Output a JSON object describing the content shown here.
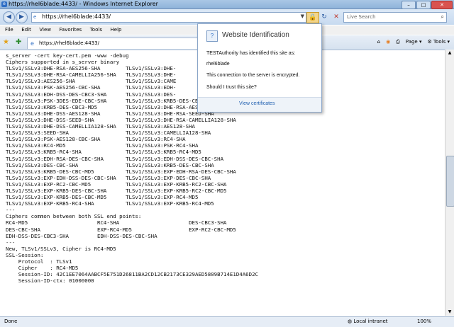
{
  "window": {
    "title": "https://rhel6blade:4433/ - Windows Internet Explorer"
  },
  "nav": {
    "url": "https://rhel6blade:4433/",
    "search_placeholder": "Live Search"
  },
  "menu": [
    "File",
    "Edit",
    "View",
    "Favorites",
    "Tools",
    "Help"
  ],
  "tab": {
    "label": "https://rhel6blade:4433/"
  },
  "toolbar": {
    "page": "Page",
    "tools": "Tools"
  },
  "popup": {
    "title": "Website Identification",
    "line1": "TESTAuthority has identified this site as:",
    "site": "rhel6blade",
    "line2": "This connection to the server is encrypted.",
    "line3": "Should I trust this site?",
    "link": "View certificates"
  },
  "content_lines": [
    "s_server -cert key-cert.pem -www -debug",
    "Ciphers supported in s_server binary",
    "TLSv1/SSLv3:DHE-RSA-AES256-SHA        TLSv1/SSLv3:DHE-",
    "TLSv1/SSLv3:DHE-RSA-CAMELLIA256-SHA   TLSv1/SSLv3:DHE-",
    "TLSv1/SSLv3:AES256-SHA                TLSv1/SSLv3:CAME",
    "TLSv1/SSLv3:PSK-AES256-CBC-SHA        TLSv1/SSLv3:EDH-",
    "TLSv1/SSLv3:EDH-DSS-DES-CBC3-SHA      TLSv1/SSLv3:DES-",
    "TLSv1/SSLv3:PSK-3DES-EDE-CBC-SHA      TLSv1/SSLv3:KRB5-DES-CBC3-SHA",
    "TLSv1/SSLv3:KRB5-DES-CBC3-MD5         TLSv1/SSLv3:DHE-RSA-AES128-SHA",
    "TLSv1/SSLv3:DHE-DSS-AES128-SHA        TLSv1/SSLv3:DHE-RSA-SEED-SHA",
    "TLSv1/SSLv3:DHE-DSS-SEED-SHA          TLSv1/SSLv3:DHE-RSA-CAMELLIA128-SHA",
    "TLSv1/SSLv3:DHE-DSS-CAMELLIA128-SHA   TLSv1/SSLv3:AES128-SHA",
    "TLSv1/SSLv3:SEED-SHA                  TLSv1/SSLv3:CAMELLIA128-SHA",
    "TLSv1/SSLv3:PSK-AES128-CBC-SHA        TLSv1/SSLv3:RC4-SHA",
    "TLSv1/SSLv3:RC4-MD5                   TLSv1/SSLv3:PSK-RC4-SHA",
    "TLSv1/SSLv3:KRB5-RC4-SHA              TLSv1/SSLv3:KRB5-RC4-MD5",
    "TLSv1/SSLv3:EDH-RSA-DES-CBC-SHA       TLSv1/SSLv3:EDH-DSS-DES-CBC-SHA",
    "TLSv1/SSLv3:DES-CBC-SHA               TLSv1/SSLv3:KRB5-DES-CBC-SHA",
    "TLSv1/SSLv3:KRB5-DES-CBC-MD5          TLSv1/SSLv3:EXP-EDH-RSA-DES-CBC-SHA",
    "TLSv1/SSLv3:EXP-EDH-DSS-DES-CBC-SHA   TLSv1/SSLv3:EXP-DES-CBC-SHA",
    "TLSv1/SSLv3:EXP-RC2-CBC-MD5           TLSv1/SSLv3:EXP-KRB5-RC2-CBC-SHA",
    "TLSv1/SSLv3:EXP-KRB5-DES-CBC-SHA      TLSv1/SSLv3:EXP-KRB5-RC2-CBC-MD5",
    "TLSv1/SSLv3:EXP-KRB5-DES-CBC-MD5      TLSv1/SSLv3:EXP-RC4-MD5",
    "TLSv1/SSLv3:EXP-KRB5-RC4-SHA          TLSv1/SSLv3:EXP-KRB5-RC4-MD5",
    "---",
    "Ciphers common between both SSL end points:",
    "RC4-MD5                      RC4-SHA                      DES-CBC3-SHA",
    "DES-CBC-SHA                  EXP-RC4-MD5                  EXP-RC2-CBC-MD5",
    "EDH-DSS-DES-CBC3-SHA         EDH-DSS-DES-CBC-SHA",
    "---",
    "New, TLSv1/SSLv3, Cipher is RC4-MD5",
    "SSL-Session:",
    "    Protocol  : TLSv1",
    "    Cipher    : RC4-MD5",
    "    Session-ID: 42C1EE7064AABCF5E751D26811BA2CD12CB2173CE329AED5809B714E1D4A6D2C",
    "    Session-ID-ctx: 01000000"
  ],
  "status": {
    "text": "Done",
    "zone": "Local intranet",
    "zoom": "100%"
  }
}
